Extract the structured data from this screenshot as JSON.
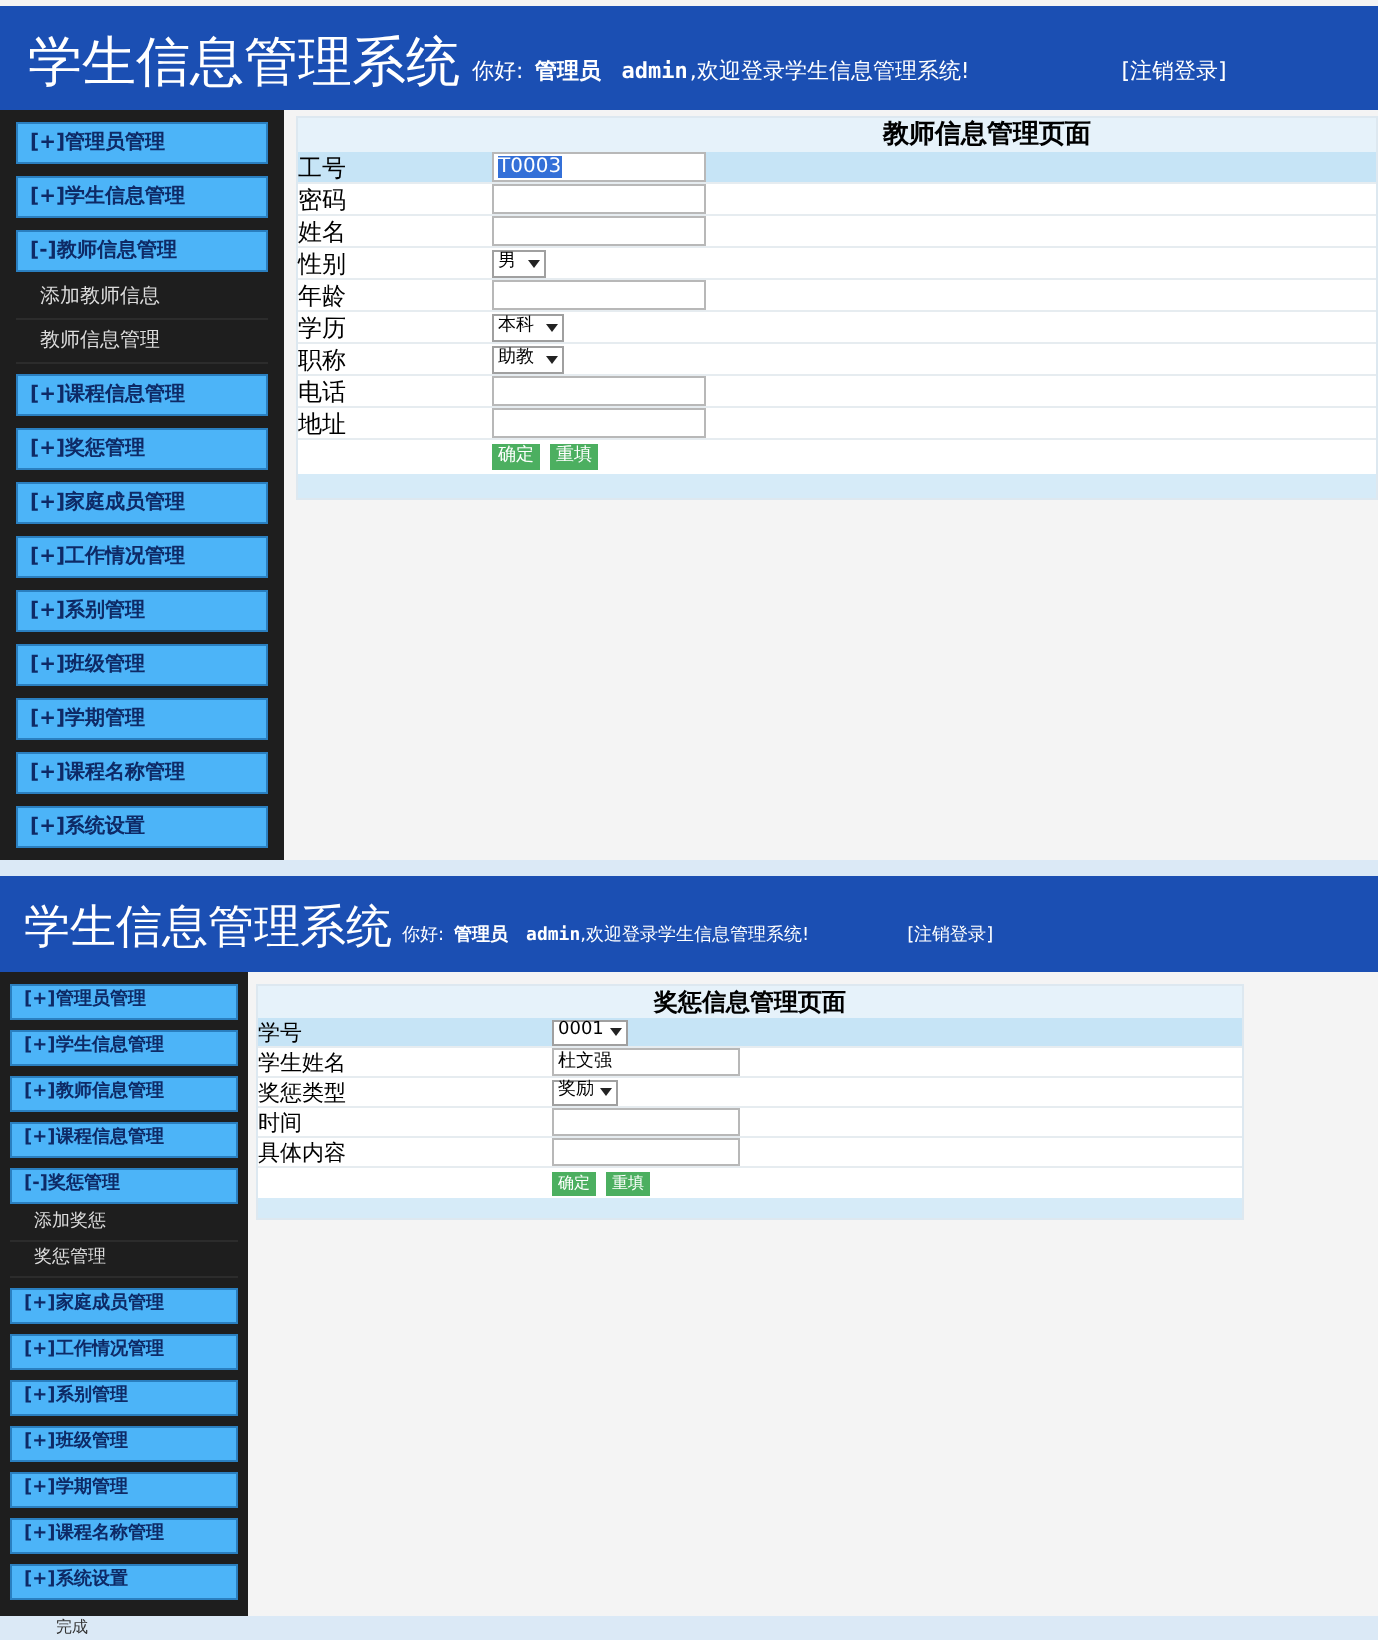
{
  "panels": [
    {
      "header": {
        "title": "学生信息管理系统",
        "greeting": "你好:",
        "role": "管理员",
        "user": "admin",
        "welcome": ",欢迎登录学生信息管理系统!",
        "logout": "[注销登录]"
      },
      "sidebar": [
        {
          "label": "[+]管理员管理"
        },
        {
          "label": "[+]学生信息管理"
        },
        {
          "label": "[-]教师信息管理",
          "children": [
            "添加教师信息",
            "教师信息管理"
          ]
        },
        {
          "label": "[+]课程信息管理"
        },
        {
          "label": "[+]奖惩管理"
        },
        {
          "label": "[+]家庭成员管理"
        },
        {
          "label": "[+]工作情况管理"
        },
        {
          "label": "[+]系别管理"
        },
        {
          "label": "[+]班级管理"
        },
        {
          "label": "[+]学期管理"
        },
        {
          "label": "[+]课程名称管理"
        },
        {
          "label": "[+]系统设置"
        }
      ],
      "form": {
        "title": "教师信息管理页面",
        "rows": [
          {
            "kind": "text",
            "label": "工号",
            "value": "T0003",
            "selected": true
          },
          {
            "kind": "text",
            "label": "密码"
          },
          {
            "kind": "text",
            "label": "姓名"
          },
          {
            "kind": "select",
            "label": "性别",
            "value": "男"
          },
          {
            "kind": "text",
            "label": "年龄"
          },
          {
            "kind": "select",
            "label": "学历",
            "value": "本科"
          },
          {
            "kind": "select",
            "label": "职称",
            "value": "助教"
          },
          {
            "kind": "text",
            "label": "电话"
          },
          {
            "kind": "text",
            "label": "地址"
          }
        ],
        "buttons": [
          "确定",
          "重填"
        ]
      }
    },
    {
      "header": {
        "title": "学生信息管理系统",
        "greeting": "你好:",
        "role": "管理员",
        "user": "admin",
        "welcome": ",欢迎登录学生信息管理系统!",
        "logout": "[注销登录]"
      },
      "sidebar": [
        {
          "label": "[+]管理员管理"
        },
        {
          "label": "[+]学生信息管理"
        },
        {
          "label": "[+]教师信息管理"
        },
        {
          "label": "[+]课程信息管理"
        },
        {
          "label": "[-]奖惩管理",
          "children": [
            "添加奖惩",
            "奖惩管理"
          ]
        },
        {
          "label": "[+]家庭成员管理"
        },
        {
          "label": "[+]工作情况管理"
        },
        {
          "label": "[+]系别管理"
        },
        {
          "label": "[+]班级管理"
        },
        {
          "label": "[+]学期管理"
        },
        {
          "label": "[+]课程名称管理"
        },
        {
          "label": "[+]系统设置"
        }
      ],
      "form": {
        "title": "奖惩信息管理页面",
        "rows": [
          {
            "kind": "select",
            "label": "学号",
            "value": "0001"
          },
          {
            "kind": "text",
            "label": "学生姓名",
            "value": "杜文强"
          },
          {
            "kind": "select",
            "label": "奖惩类型",
            "value": "奖励"
          },
          {
            "kind": "text",
            "label": "时间"
          },
          {
            "kind": "text",
            "label": "具体内容"
          }
        ],
        "buttons": [
          "确定",
          "重填"
        ]
      },
      "status": "完成"
    }
  ]
}
